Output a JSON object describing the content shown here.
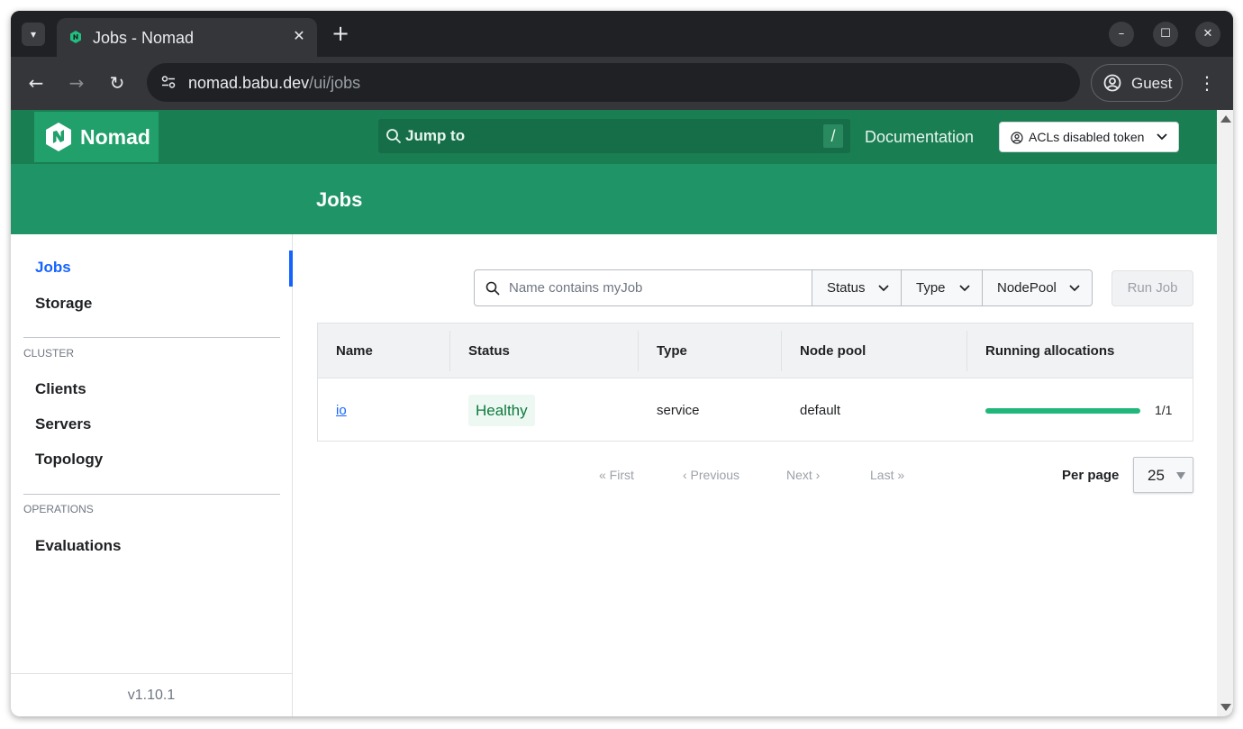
{
  "browser": {
    "tab_title": "Jobs - Nomad",
    "url_host": "nomad.babu.dev",
    "url_path": "/ui/jobs",
    "profile_label": "Guest"
  },
  "nav": {
    "brand": "Nomad",
    "jump_to_label": "Jump to",
    "jump_to_shortcut": "/",
    "documentation": "Documentation",
    "acl_token_label": "ACLs disabled token"
  },
  "page": {
    "title": "Jobs"
  },
  "sidebar": {
    "items_top": [
      {
        "label": "Jobs",
        "active": true
      },
      {
        "label": "Storage",
        "active": false
      }
    ],
    "cluster_heading": "CLUSTER",
    "cluster_items": [
      {
        "label": "Clients"
      },
      {
        "label": "Servers"
      },
      {
        "label": "Topology"
      }
    ],
    "operations_heading": "OPERATIONS",
    "operations_items": [
      {
        "label": "Evaluations"
      }
    ],
    "version": "v1.10.1"
  },
  "filters": {
    "search_placeholder": "Name contains myJob",
    "status_label": "Status",
    "type_label": "Type",
    "nodepool_label": "NodePool",
    "run_job_label": "Run Job"
  },
  "table": {
    "columns": [
      "Name",
      "Status",
      "Type",
      "Node pool",
      "Running allocations"
    ],
    "rows": [
      {
        "name": "io",
        "status": "Healthy",
        "type": "service",
        "node_pool": "default",
        "running_fraction": 1.0,
        "allocations": "1/1"
      }
    ]
  },
  "pagination": {
    "first": "« First",
    "previous": "‹ Previous",
    "next": "Next ›",
    "last": "Last »",
    "per_page_label": "Per page",
    "per_page_value": "25"
  },
  "colors": {
    "nav_green": "#1a7e53",
    "header_green": "#1f9467",
    "brand_green": "#21a06b",
    "link_blue": "#1563ff",
    "healthy_green": "#0d7a3e",
    "alloc_bar": "#22b77a"
  },
  "icons": {
    "tab_search": "chevron-down-icon",
    "favicon": "nomad-favicon-icon",
    "close": "close-icon",
    "new_tab": "plus-icon",
    "back": "back-arrow-icon",
    "forward": "forward-arrow-icon",
    "reload": "reload-icon",
    "site_info": "tune-icon",
    "profile": "account-circle-icon",
    "menu": "kebab-menu-icon",
    "search": "search-icon",
    "user": "user-circle-icon",
    "chevron": "chevron-down-icon"
  }
}
